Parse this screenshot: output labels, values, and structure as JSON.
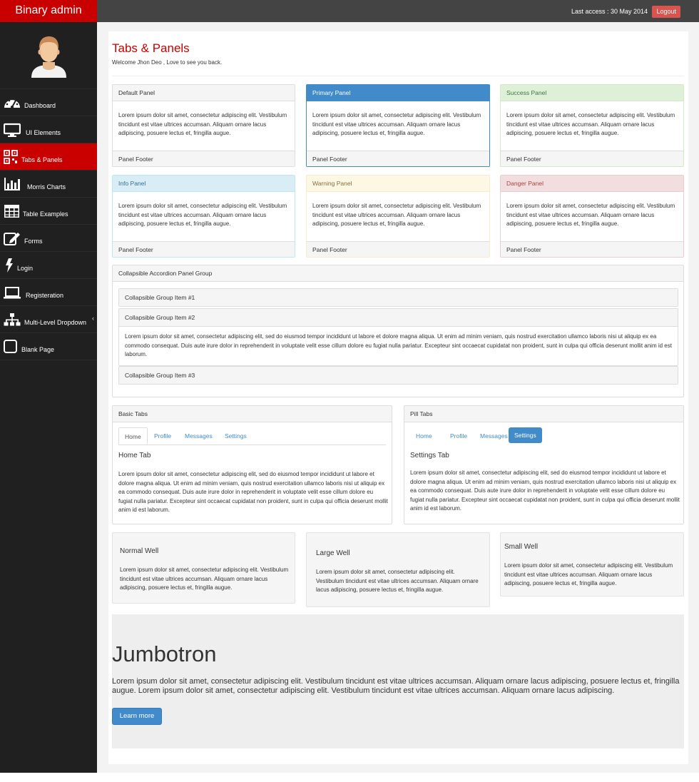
{
  "brand": "Binary admin",
  "topbar": {
    "last_access": "Last access : 30 May 2014",
    "logout": "Logout"
  },
  "sidebar": {
    "items": [
      {
        "label": "Dashboard",
        "icon": "dashboard-icon"
      },
      {
        "label": "UI Elements",
        "icon": "desktop-icon"
      },
      {
        "label": "Tabs & Panels",
        "icon": "qrcode-icon",
        "active": true
      },
      {
        "label": "Morris Charts",
        "icon": "bar-chart-icon"
      },
      {
        "label": "Table Examples",
        "icon": "table-icon"
      },
      {
        "label": "Forms",
        "icon": "edit-icon"
      },
      {
        "label": "Login",
        "icon": "bolt-icon"
      },
      {
        "label": "Registeration",
        "icon": "laptop-icon"
      },
      {
        "label": "Multi-Level Dropdown",
        "icon": "sitemap-icon"
      },
      {
        "label": "Blank Page",
        "icon": "square-icon"
      }
    ]
  },
  "page": {
    "title": "Tabs & Panels",
    "welcome": "Welcome Jhon Deo , Love to see you back."
  },
  "panels": {
    "body_text": "Lorem ipsum dolor sit amet, consectetur adipiscing elit. Vestibulum tincidunt est vitae ultrices accumsan. Aliquam ornare lacus adipiscing, posuere lectus et, fringilla augue.",
    "footer": "Panel Footer",
    "default": "Default Panel",
    "primary": "Primary Panel",
    "success": "Success Panel",
    "info": "Info Panel",
    "warning": "Warning Panel",
    "danger": "Danger Panel"
  },
  "accordion": {
    "title": "Collapsible Accordion Panel Group",
    "item1": "Collapsible Group Item #1",
    "item2": "Collapsible Group Item #2",
    "item3": "Collapsible Group Item #3",
    "item2_body": "Lorem ipsum dolor sit amet, consectetur adipiscing elit, sed do eiusmod tempor incididunt ut labore et dolore magna aliqua. Ut enim ad minim veniam, quis nostrud exercitation ullamco laboris nisi ut aliquip ex ea commodo consequat. Duis aute irure dolor in reprehenderit in voluptate velit esse cillum dolore eu fugiat nulla pariatur. Excepteur sint occaecat cupidatat non proident, sunt in culpa qui officia deserunt mollit anim id est laborum."
  },
  "tabs": {
    "basic_title": "Basic Tabs",
    "pill_title": "Pill Tabs",
    "labels": [
      "Home",
      "Profile",
      "Messages",
      "Settings"
    ],
    "basic_tab_title": "Home Tab",
    "pill_tab_title": "Settings Tab",
    "tab_text": "Lorem ipsum dolor sit amet, consectetur adipiscing elit, sed do eiusmod tempor incididunt ut labore et dolore magna aliqua. Ut enim ad minim veniam, quis nostrud exercitation ullamco laboris nisi ut aliquip ex ea commodo consequat. Duis aute irure dolor in reprehenderit in voluptate velit esse cillum dolore eu fugiat nulla pariatur. Excepteur sint occaecat cupidatat non proident, sunt in culpa qui officia deserunt mollit anim id est laborum."
  },
  "wells": {
    "normal": "Normal Well",
    "large": "Large Well",
    "small": "Small Well",
    "text": "Lorem ipsum dolor sit amet, consectetur adipiscing elit. Vestibulum tincidunt est vitae ultrices accumsan. Aliquam ornare lacus adipiscing, posuere lectus et, fringilla augue."
  },
  "jumbotron": {
    "title": "Jumbotron",
    "text": "Lorem ipsum dolor sit amet, consectetur adipiscing elit. Vestibulum tincidunt est vitae ultrices accumsan. Aliquam ornare lacus adipiscing, posuere lectus et, fringilla augue. Lorem ipsum dolor sit amet, consectetur adipiscing elit. Vestibulum tincidunt est vitae ultrices accumsan. Aliquam ornare lacus adipiscing.",
    "button": "Learn more"
  },
  "colors": {
    "brand_red": "#c90000",
    "primary_blue": "#428bca",
    "sidebar_bg": "#202020",
    "topbar_bg": "#444444"
  }
}
